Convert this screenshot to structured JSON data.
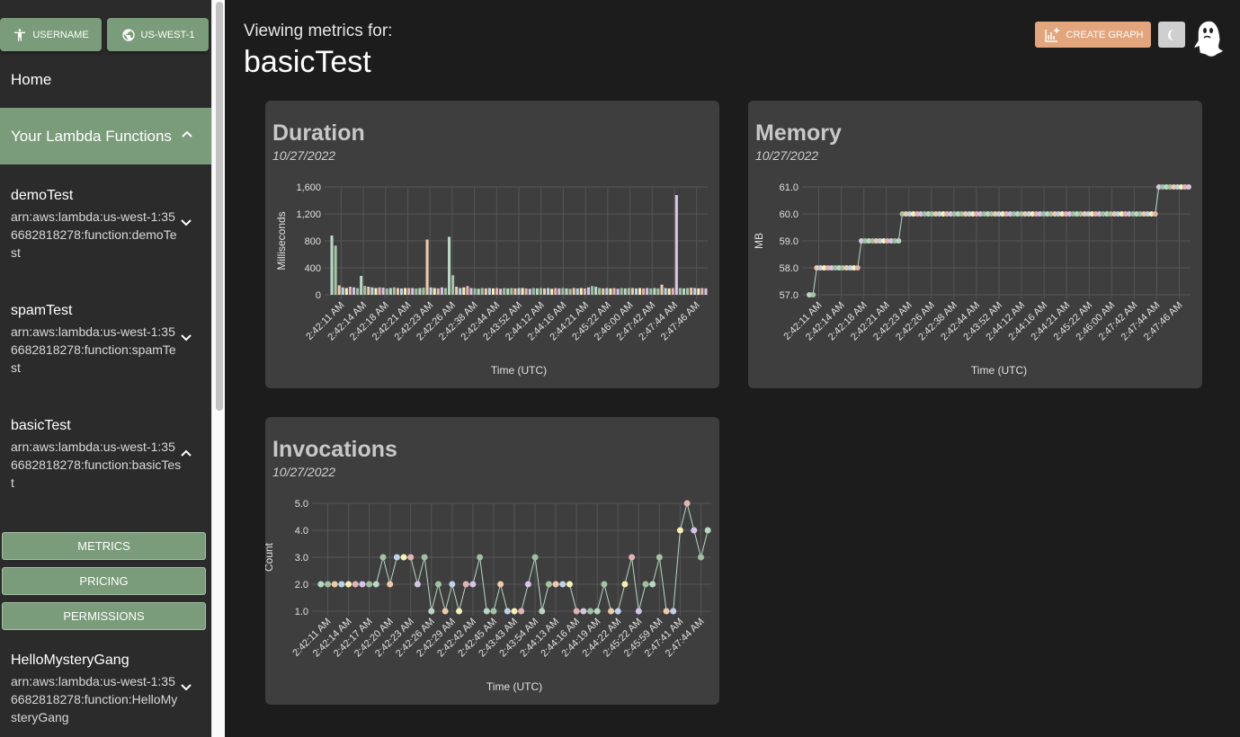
{
  "sidebar": {
    "username_label": "USERNAME",
    "region_label": "US-WEST-1",
    "home": "Home",
    "your_functions": "Your Lambda Functions",
    "functions": [
      {
        "name": "demoTest",
        "arn": "arn:aws:lambda:us-west-1:356682818278:function:demoTest",
        "expanded": false
      },
      {
        "name": "spamTest",
        "arn": "arn:aws:lambda:us-west-1:356682818278:function:spamTest",
        "expanded": false
      },
      {
        "name": "basicTest",
        "arn": "arn:aws:lambda:us-west-1:356682818278:function:basicTest",
        "expanded": true
      },
      {
        "name": "HelloMysteryGang",
        "arn": "arn:aws:lambda:us-west-1:356682818278:function:HelloMysteryGang",
        "expanded": false
      }
    ],
    "actions": {
      "metrics": "METRICS",
      "pricing": "PRICING",
      "permissions": "PERMISSIONS"
    }
  },
  "header": {
    "viewing": "Viewing metrics for:",
    "function_name": "basicTest",
    "create_graph": "CREATE GRAPH"
  },
  "icons": {
    "user": "accessibility-icon",
    "region": "globe-icon",
    "chevron": "chevron-icon",
    "graph": "add-chart-icon",
    "theme": "moon-icon",
    "logo": "ghost-logo-icon"
  },
  "colors": {
    "accent": "#7a9c7a",
    "create": "#e3a57c",
    "card": "#3e3e3e"
  },
  "chart_data": [
    {
      "type": "bar",
      "title": "Duration",
      "subtitle": "10/27/2022",
      "xlabel": "Time (UTC)",
      "ylabel": "Milliseconds",
      "ylim": [
        0,
        1600
      ],
      "yticks": [
        "0",
        "400",
        "800",
        "1,200",
        "1,600"
      ],
      "tick_labels": [
        "2:42:11 AM",
        "2:42:14 AM",
        "2:42:18 AM",
        "2:42:21 AM",
        "2:42:23 AM",
        "2:42:26 AM",
        "2:42:38 AM",
        "2:42:44 AM",
        "2:43:52 AM",
        "2:44:12 AM",
        "2:44:16 AM",
        "2:44:21 AM",
        "2:45:22 AM",
        "2:46:00 AM",
        "2:47:42 AM",
        "2:47:44 AM",
        "2:47:46 AM"
      ],
      "values": [
        880,
        730,
        140,
        110,
        100,
        120,
        110,
        100,
        280,
        130,
        120,
        110,
        100,
        110,
        105,
        95,
        100,
        110,
        100,
        95,
        100,
        100,
        100,
        95,
        100,
        105,
        820,
        110,
        100,
        95,
        110,
        100,
        860,
        290,
        120,
        100,
        110,
        130,
        100,
        95,
        90,
        100,
        95,
        100,
        95,
        100,
        90,
        100,
        95,
        100,
        95,
        100,
        100,
        95,
        90,
        100,
        95,
        100,
        95,
        100,
        90,
        100,
        95,
        100,
        95,
        90,
        100,
        95,
        100,
        95,
        110,
        130,
        120,
        100,
        95,
        100,
        95,
        100,
        90,
        100,
        95,
        100,
        100,
        95,
        100,
        95,
        100,
        95,
        100,
        95,
        150,
        100,
        95,
        100,
        1480,
        100,
        95,
        100,
        105,
        100,
        95,
        100,
        95
      ],
      "grid": true
    },
    {
      "type": "line",
      "title": "Memory",
      "subtitle": "10/27/2022",
      "xlabel": "Time (UTC)",
      "ylabel": "MB",
      "ylim": [
        57.0,
        61.0
      ],
      "yticks": [
        "57.0",
        "58.0",
        "59.0",
        "60.0",
        "61.0"
      ],
      "tick_labels": [
        "2:42:11 AM",
        "2:42:14 AM",
        "2:42:18 AM",
        "2:42:21 AM",
        "2:42:23 AM",
        "2:42:26 AM",
        "2:42:38 AM",
        "2:42:44 AM",
        "2:43:52 AM",
        "2:44:12 AM",
        "2:44:16 AM",
        "2:44:21 AM",
        "2:45:22 AM",
        "2:46:00 AM",
        "2:47:42 AM",
        "2:47:44 AM",
        "2:47:46 AM"
      ],
      "values": [
        57,
        57,
        58,
        58,
        58,
        58,
        58,
        58,
        58,
        58,
        58,
        58,
        58,
        58,
        59,
        59,
        59,
        59,
        59,
        59,
        59,
        59,
        59,
        59,
        59,
        60,
        60,
        60,
        60,
        60,
        60,
        60,
        60,
        60,
        60,
        60,
        60,
        60,
        60,
        60,
        60,
        60,
        60,
        60,
        60,
        60,
        60,
        60,
        60,
        60,
        60,
        60,
        60,
        60,
        60,
        60,
        60,
        60,
        60,
        60,
        60,
        60,
        60,
        60,
        60,
        60,
        60,
        60,
        60,
        60,
        60,
        60,
        60,
        60,
        60,
        60,
        60,
        60,
        60,
        60,
        60,
        60,
        60,
        60,
        60,
        60,
        60,
        60,
        60,
        60,
        60,
        60,
        60,
        60,
        61,
        61,
        61,
        61,
        61,
        61,
        61,
        61,
        61
      ],
      "grid": true
    },
    {
      "type": "line",
      "title": "Invocations",
      "subtitle": "10/27/2022",
      "xlabel": "Time (UTC)",
      "ylabel": "Count",
      "ylim": [
        1.0,
        5.0
      ],
      "yticks": [
        "1.0",
        "2.0",
        "3.0",
        "4.0",
        "5.0"
      ],
      "tick_labels": [
        "2:42:11 AM",
        "2:42:14 AM",
        "2:42:17 AM",
        "2:42:20 AM",
        "2:42:23 AM",
        "2:42:26 AM",
        "2:42:29 AM",
        "2:42:42 AM",
        "2:42:45 AM",
        "2:43:43 AM",
        "2:43:54 AM",
        "2:44:13 AM",
        "2:44:16 AM",
        "2:44:19 AM",
        "2:44:22 AM",
        "2:45:22 AM",
        "2:45:59 AM",
        "2:47:41 AM",
        "2:47:44 AM"
      ],
      "values": [
        2,
        2,
        2,
        2,
        2,
        2,
        2,
        2,
        2,
        3,
        2,
        3,
        3,
        3,
        2,
        3,
        1,
        2,
        1,
        2,
        1,
        2,
        2,
        3,
        1,
        1,
        2,
        1,
        1,
        1,
        2,
        3,
        1,
        2,
        2,
        2,
        2,
        1,
        1,
        1,
        1,
        2,
        1,
        1,
        2,
        3,
        1,
        2,
        2,
        3,
        1,
        1,
        4,
        5,
        4,
        3,
        4
      ],
      "grid": true
    }
  ]
}
